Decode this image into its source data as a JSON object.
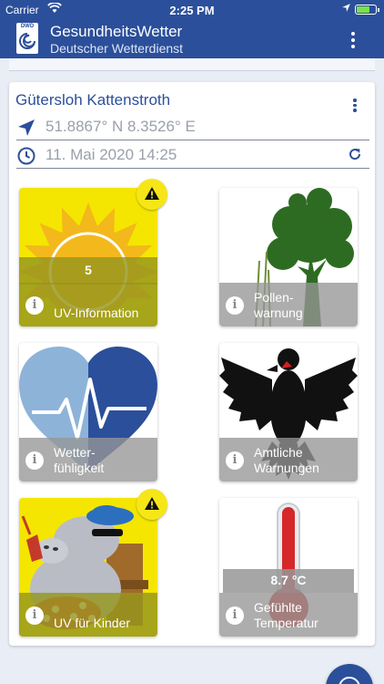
{
  "status": {
    "carrier": "Carrier",
    "time": "2:25 PM"
  },
  "app": {
    "title": "GesundheitsWetter",
    "subtitle": "Deutscher Wetterdienst",
    "logo_text": "DWD"
  },
  "location": {
    "name": "Gütersloh Kattenstroth",
    "coords": "51.8867° N 8.3526° E",
    "datetime": "11. Mai 2020 14:25"
  },
  "tiles": [
    {
      "label": "UV-Information",
      "value": "5",
      "warning": true,
      "icon": "sun-icon"
    },
    {
      "label": "Pollen-\nwarnung",
      "warning": false,
      "icon": "tree-icon"
    },
    {
      "label": "Wetter-\nfühligkeit",
      "warning": false,
      "icon": "heart-icon"
    },
    {
      "label": "Amtliche\nWarnungen",
      "warning": false,
      "icon": "eagle-icon"
    },
    {
      "label": "UV für Kinder",
      "warning": true,
      "icon": "hippo-icon"
    },
    {
      "label": "Gefühlte\nTemperatur",
      "value": "8.7 °C",
      "warning": false,
      "icon": "thermometer-icon"
    }
  ],
  "colors": {
    "primary": "#2b4f9a",
    "warning": "#f7e617",
    "uv_yellow": "#f4e600"
  }
}
